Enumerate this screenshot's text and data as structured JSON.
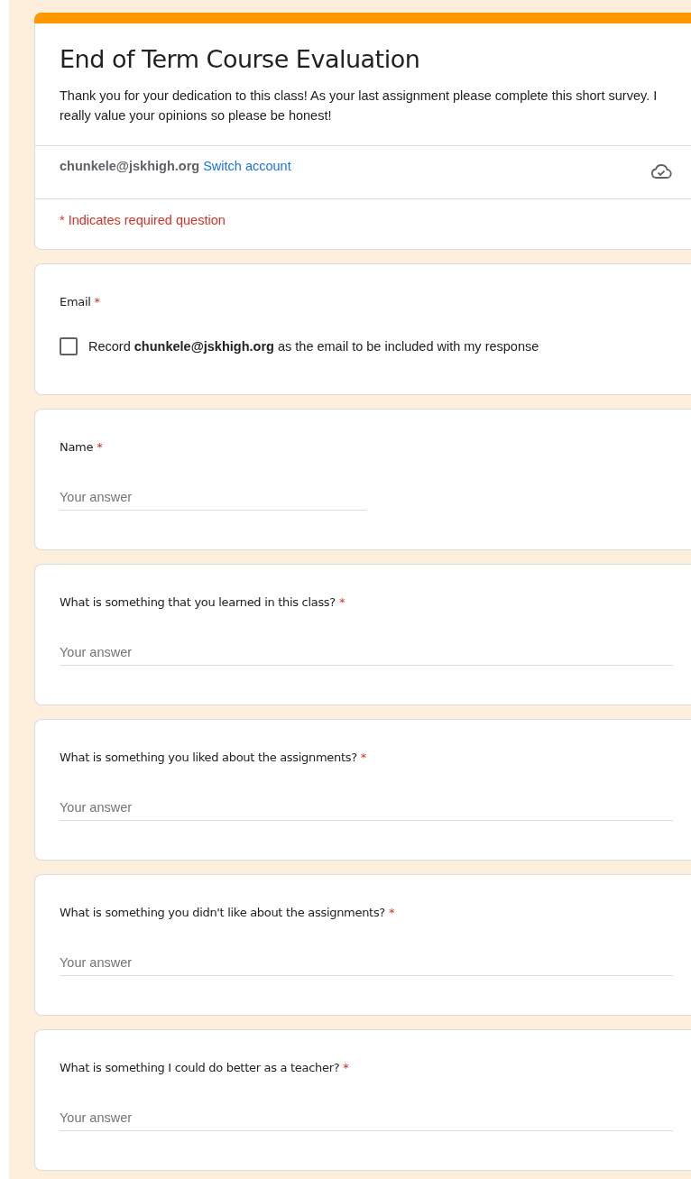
{
  "header": {
    "title": "End of Term Course Evaluation",
    "description": "Thank you for your dedication to this class! As your last assignment please complete this short survey. I really value your opinions so please be honest!",
    "account_email": "chunkele@jskhigh.org",
    "switch_account": "Switch account",
    "required_note": "* Indicates required question"
  },
  "questions": [
    {
      "kind": "checkbox",
      "title": "Email",
      "required_mark": "*",
      "checkbox_label": "Record **chunkele@jskhigh.org** as the email to be included with my response",
      "checked": false
    },
    {
      "kind": "short_answer",
      "title": "Name",
      "required_mark": "*",
      "placeholder": "Your answer"
    },
    {
      "kind": "paragraph",
      "title": "What is something that you learned in this class?",
      "required_mark": "*",
      "placeholder": "Your answer"
    },
    {
      "kind": "paragraph",
      "title": "What is something you liked about the assignments?",
      "required_mark": "*",
      "placeholder": "Your answer"
    },
    {
      "kind": "paragraph",
      "title": "What is something you didn't like about the assignments?",
      "required_mark": "*",
      "placeholder": "Your answer"
    },
    {
      "kind": "paragraph",
      "title": "What is something I could do better as a teacher?",
      "required_mark": "*",
      "placeholder": "Your answer"
    }
  ]
}
